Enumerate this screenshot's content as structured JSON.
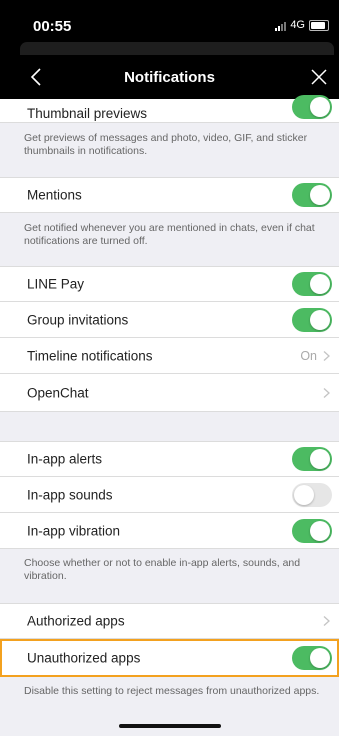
{
  "status": {
    "time": "00:55",
    "network": "4G"
  },
  "nav": {
    "title": "Notifications"
  },
  "icons": {
    "back": "chevron-left-icon",
    "close": "close-icon",
    "disclosure": "chevron-right-icon",
    "signal": "signal-icon",
    "battery": "battery-icon"
  },
  "colors": {
    "toggle_on": "#4cbb62",
    "toggle_off": "#e6e6e6",
    "highlight": "#f3a11f",
    "nav_bg": "#000000"
  },
  "sections": {
    "thumbnail": {
      "label": "Thumbnail previews",
      "enabled": true,
      "description": "Get previews of messages and photo, video, GIF, and sticker thumbnails in notifications."
    },
    "mentions": {
      "label": "Mentions",
      "enabled": true,
      "description": "Get notified whenever you are mentioned in chats, even if chat notifications are turned off."
    },
    "line_pay": {
      "label": "LINE Pay",
      "enabled": true
    },
    "group_invitations": {
      "label": "Group invitations",
      "enabled": true
    },
    "timeline": {
      "label": "Timeline notifications",
      "value": "On"
    },
    "openchat": {
      "label": "OpenChat"
    },
    "inapp_alerts": {
      "label": "In-app alerts",
      "enabled": true
    },
    "inapp_sounds": {
      "label": "In-app sounds",
      "enabled": false
    },
    "inapp_vibration": {
      "label": "In-app vibration",
      "enabled": true
    },
    "inapp_description": "Choose whether or not to enable in-app alerts, sounds, and vibration.",
    "authorized_apps": {
      "label": "Authorized apps"
    },
    "unauthorized_apps": {
      "label": "Unauthorized apps",
      "enabled": true,
      "description": "Disable this setting to reject messages from unauthorized apps."
    }
  }
}
